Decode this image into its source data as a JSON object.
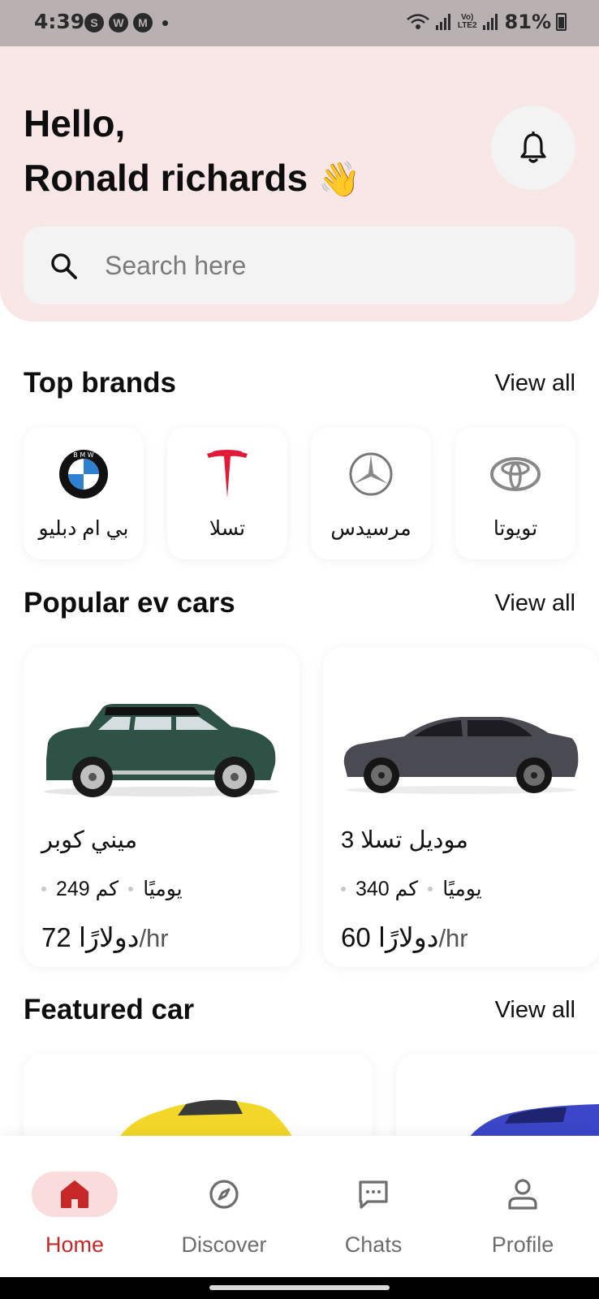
{
  "status_bar": {
    "time": "4:39",
    "battery": "81%",
    "network": "LTE2",
    "volte": "Vo)",
    "app_icons": [
      "S",
      "W",
      "M"
    ]
  },
  "header": {
    "greeting_line1": "Hello,",
    "greeting_line2": "Ronald richards",
    "wave_emoji": "👋",
    "bell_icon": "bell-icon"
  },
  "search": {
    "placeholder": "Search here",
    "value": ""
  },
  "top_brands": {
    "title": "Top brands",
    "view_all": "View all",
    "brands": [
      {
        "name": "بي ام دبليو",
        "logo": "bmw-logo"
      },
      {
        "name": "تسلا",
        "logo": "tesla-logo"
      },
      {
        "name": "مرسيدس",
        "logo": "mercedes-logo"
      },
      {
        "name": "تويوتا",
        "logo": "toyota-logo"
      }
    ]
  },
  "popular_ev": {
    "title": "Popular ev cars",
    "view_all": "View all",
    "cars": [
      {
        "name": "ميني كوبر",
        "range": "249 كم",
        "period": "يوميًا",
        "price": "72 دولارًا",
        "unit": "/hr",
        "color": "#2f5246"
      },
      {
        "name": "موديل تسلا 3",
        "range": "340 كم",
        "period": "يوميًا",
        "price": "60 دولارًا",
        "unit": "/hr",
        "color": "#4a4b52"
      }
    ]
  },
  "featured": {
    "title": "Featured car",
    "view_all": "View all",
    "colors": [
      "#f2d729",
      "#3b46c9"
    ]
  },
  "bottom_nav": {
    "items": [
      {
        "label": "Home",
        "icon": "home-icon",
        "active": true
      },
      {
        "label": "Discover",
        "icon": "compass-icon",
        "active": false
      },
      {
        "label": "Chats",
        "icon": "chat-icon",
        "active": false
      },
      {
        "label": "Profile",
        "icon": "profile-icon",
        "active": false
      }
    ]
  },
  "colors": {
    "header_bg": "#f9e7e7",
    "accent": "#c62828",
    "active_pill": "#fadcdc"
  }
}
